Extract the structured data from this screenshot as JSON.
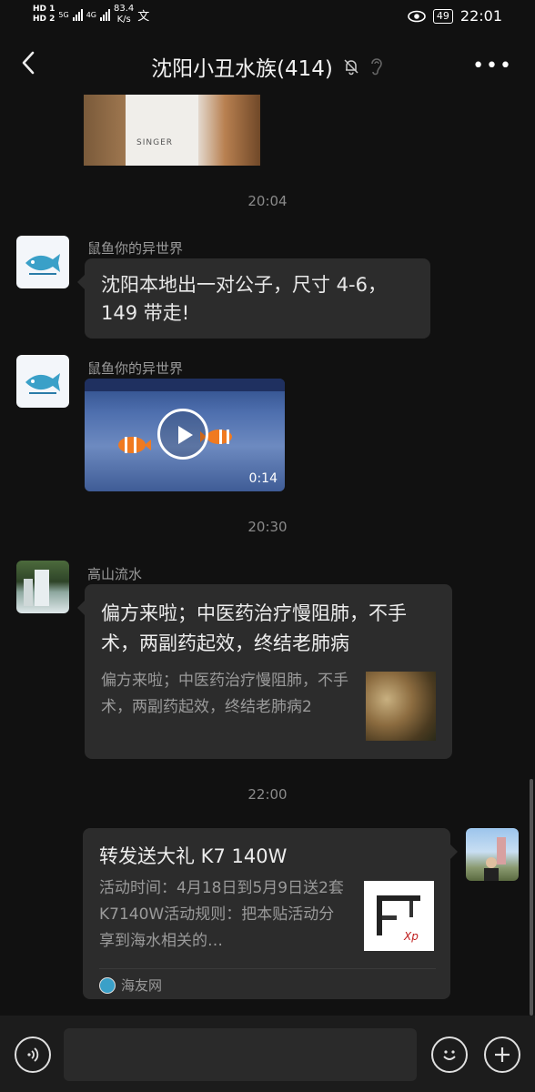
{
  "status": {
    "hd1": "HD 1",
    "hd2": "HD 2",
    "net1": "5G",
    "net2": "4G",
    "speed_val": "83.4",
    "speed_unit": "K/s",
    "battery": "49",
    "time": "22:01"
  },
  "header": {
    "title": "沈阳小丑水族(414)"
  },
  "messages": {
    "video_brand": "SINGER",
    "time1": "20:04",
    "sender1": "鼠鱼你的异世界",
    "text1": "沈阳本地出一对公子，尺寸 4-6，149 带走!",
    "sender2": "鼠鱼你的异世界",
    "video_duration": "0:14",
    "time2": "20:30",
    "sender3": "高山流水",
    "link1_title": "偏方来啦；中医药治疗慢阻肺，不手术，两副药起效，终结老肺病",
    "link1_desc": "偏方来啦；中医药治疗慢阻肺，不手术，两副药起效，终结老肺病2",
    "time3": "22:00",
    "link2_title": "转发送大礼 K7 140W",
    "link2_desc": "活动时间：4月18日到5月9日送2套K7140W活动规则：把本贴活动分享到海水相关的…",
    "link2_source": "海友网",
    "link2_thumb_text": "Xp"
  },
  "icons": {
    "back": "back-arrow-icon",
    "mute": "bell-off-icon",
    "ear": "ear-icon",
    "more": "more-dots-icon",
    "voice": "voice-icon",
    "emoji": "emoji-icon",
    "add": "plus-icon"
  },
  "colors": {
    "background": "#111111",
    "bubble": "#2c2c2c",
    "timestamp": "#8a8a8a"
  }
}
